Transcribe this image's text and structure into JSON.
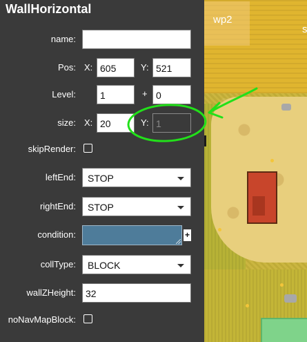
{
  "window": {
    "title": "WallHorizontal"
  },
  "fields": {
    "name": {
      "label": "name:",
      "value": ""
    },
    "pos": {
      "label": "Pos:",
      "x_label": "X:",
      "x": "605",
      "y_label": "Y:",
      "y": "521"
    },
    "level": {
      "label": "Level:",
      "value": "1",
      "plus_label": "+",
      "offset": "0"
    },
    "size": {
      "label": "size:",
      "x_label": "X:",
      "x": "20",
      "y_label": "Y:",
      "y": "1"
    },
    "skipRender": {
      "label": "skipRender:",
      "checked": false
    },
    "leftEnd": {
      "label": "leftEnd:",
      "value": "STOP"
    },
    "rightEnd": {
      "label": "rightEnd:",
      "value": "STOP"
    },
    "condition": {
      "label": "condition:",
      "value": "",
      "add_label": "+"
    },
    "collType": {
      "label": "collType:",
      "value": "BLOCK"
    },
    "wallZHeight": {
      "label": "wallZHeight:",
      "value": "32"
    },
    "noNavMapBlock": {
      "label": "noNavMapBlock:",
      "checked": false
    }
  },
  "map": {
    "waypoint_label": "wp2",
    "edge_label": "s"
  },
  "colors": {
    "panel_bg": "#3a3a3a",
    "annotation": "#22e01a",
    "condition_bg": "#4e7c9a",
    "door": "#c8452b"
  }
}
